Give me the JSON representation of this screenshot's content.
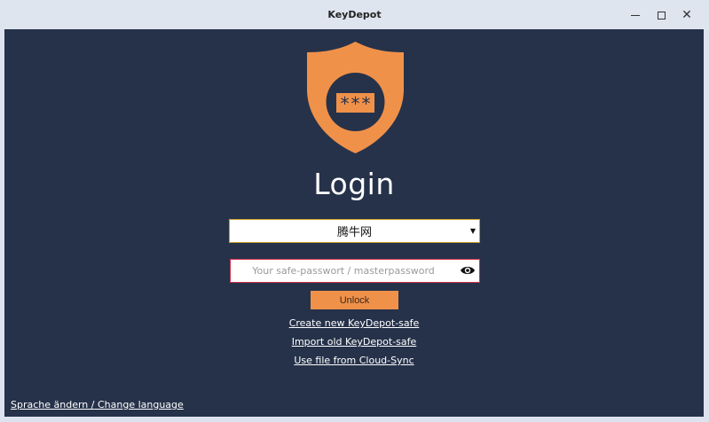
{
  "window": {
    "title": "KeyDepot",
    "controls": {
      "minimize_icon": "minimize-icon",
      "maximize_icon": "maximize-icon",
      "close_icon": "close-icon"
    }
  },
  "login": {
    "heading": "Login",
    "safe_select": {
      "selected": "腾牛网"
    },
    "password": {
      "value": "",
      "placeholder": "Your safe-passwort / masterpassword"
    },
    "unlock_label": "Unlock",
    "links": {
      "create": "Create new KeyDepot-safe",
      "import": "Import old KeyDepot-safe",
      "cloud": "Use file from Cloud-Sync"
    },
    "language_link": "Sprache ändern / Change language",
    "logo_text": "***"
  },
  "colors": {
    "background": "#26324a",
    "accent": "#f0914a",
    "select_border": "#c8a22a",
    "password_border": "#d2314a",
    "titlebar": "#dfe5ef"
  }
}
